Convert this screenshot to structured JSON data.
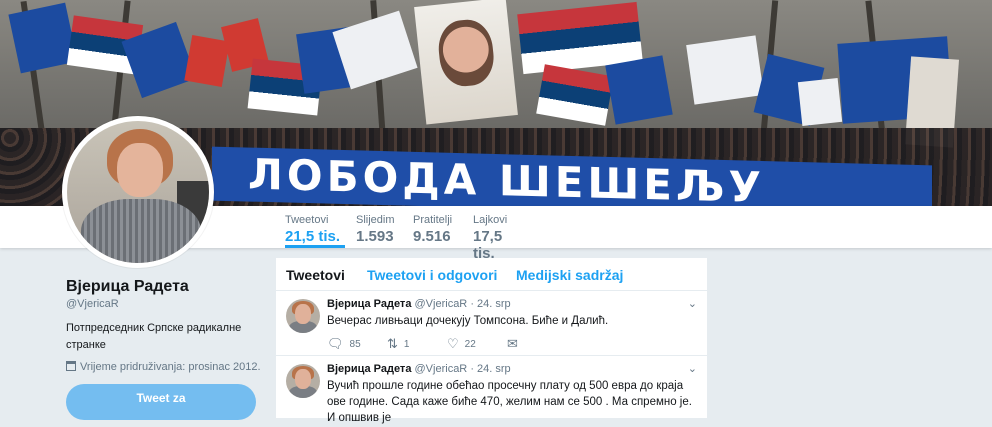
{
  "banner": {
    "sign_text": "ЛОБОДА ШЕШЕЉУ"
  },
  "profile": {
    "name": "Вјерица Радета",
    "handle": "@VjericaR",
    "bio": "Потпредседник Српске радикалне странке",
    "joined": "Vrijeme pridruživanja: prosinac 2012.",
    "tweet_button": "Tweet za"
  },
  "stats": [
    {
      "label": "Tweetovi",
      "value": "21,5 tis."
    },
    {
      "label": "Slijedim",
      "value": "1.593"
    },
    {
      "label": "Pratitelji",
      "value": "9.516"
    },
    {
      "label": "Lajkovi",
      "value": "17,5 tis."
    }
  ],
  "tabs": [
    {
      "label": "Tweetovi"
    },
    {
      "label": "Tweetovi i odgovori"
    },
    {
      "label": "Medijski sadržaj"
    }
  ],
  "tweets": [
    {
      "name": "Вјерица Радета",
      "handle": "@VjericaR",
      "date": "· 24. srp",
      "text": "Вечерас ливњаци дочекују Томпсона. Биће и Далић.",
      "replies": "85",
      "retweets": "1",
      "likes": "22"
    },
    {
      "name": "Вјерица Радета",
      "handle": "@VjericaR",
      "date": "· 24. srp",
      "text": "Вучић прошле године обећао просечну плату од 500 евра до краја ове године. Сада каже биће 470, желим нам се 500 . Ма спремно је. И опшвив је"
    }
  ],
  "icons": {
    "caret": "chevron-down-icon",
    "reply": "reply-icon",
    "retweet": "retweet-icon",
    "like": "heart-icon",
    "dm": "envelope-icon",
    "calendar": "calendar-icon"
  },
  "colors": {
    "accent": "#1da1f2",
    "background": "#e6ecf0",
    "muted": "#657786"
  }
}
